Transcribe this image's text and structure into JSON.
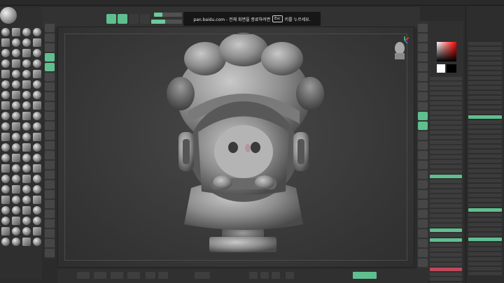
{
  "toast": {
    "prefix": "pan.baidu.com - 전체 화면을 종료하려면",
    "key": "Esc",
    "suffix": "키를 누르세요."
  },
  "colors": {
    "accent": "#5fbf8f",
    "alert": "#c0485a",
    "panel": "#303030",
    "viewport": "#3b3b3b"
  },
  "brush_size_fraction": 0.45,
  "intensity_fraction": 0.3
}
